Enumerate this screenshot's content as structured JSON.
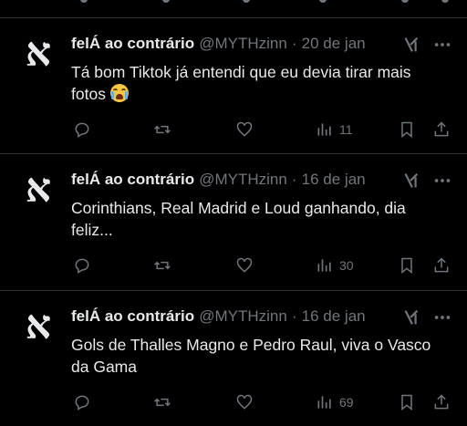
{
  "tweets": [
    {
      "name": "felÁ ao contrário",
      "handle": "@MYTHzinn",
      "separator": "·",
      "date": "20 de jan",
      "text": "Tá bom Tiktok já entendi que eu devia tirar mais fotos",
      "emoji": "loudly-crying-face",
      "views": "11"
    },
    {
      "name": "felÁ ao contrário",
      "handle": "@MYTHzinn",
      "separator": "·",
      "date": "16 de jan",
      "text": "Corinthians, Real Madrid e Loud ganhando, dia feliz...",
      "views": "30"
    },
    {
      "name": "felÁ ao contrário",
      "handle": "@MYTHzinn",
      "separator": "·",
      "date": "16 de jan",
      "text": "Gols de Thalles Magno e Pedro Raul, viva o Vasco da Gama",
      "views": "69"
    }
  ],
  "avatar_glyph": "א",
  "colors": {
    "background": "#000000",
    "text": "#e7e9ea",
    "muted": "#71767b",
    "divider": "#2f3336"
  },
  "icons": [
    "reply-icon",
    "retweet-icon",
    "like-icon",
    "views-icon",
    "bookmark-icon",
    "share-icon",
    "grok-icon",
    "more-icon"
  ]
}
